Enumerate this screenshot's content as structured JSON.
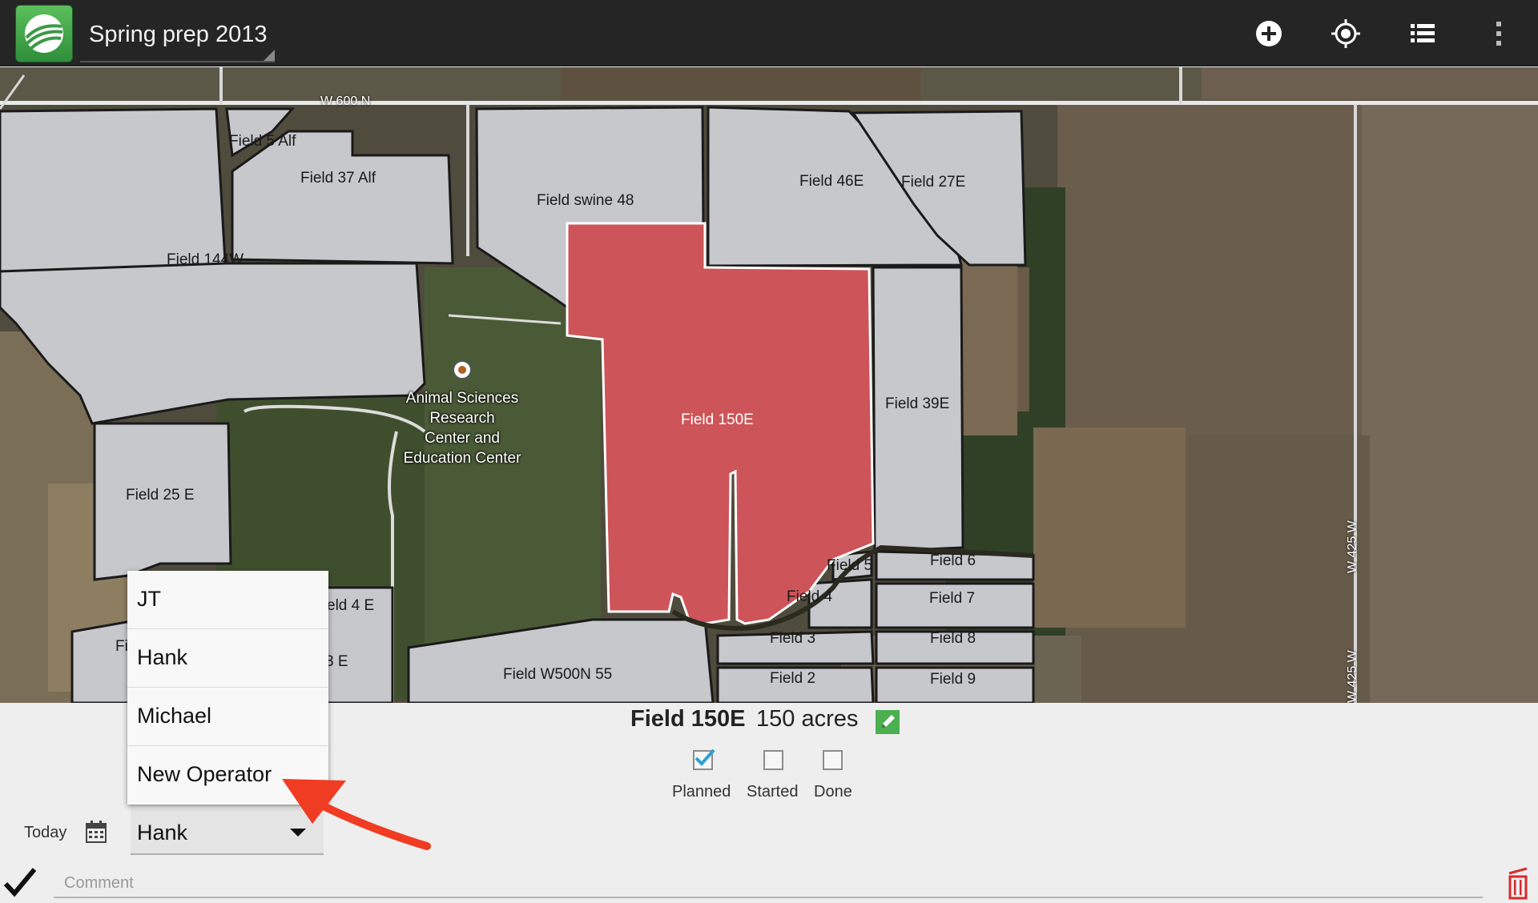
{
  "actionbar": {
    "title": "Spring prep 2013",
    "icons": [
      "app-logo-icon",
      "add-icon",
      "location-target-icon",
      "list-icon",
      "overflow-menu-icon"
    ]
  },
  "map": {
    "roads": {
      "w600n": "W 600 N",
      "w425w_upper": "W 425 W",
      "w425w_lower": "W 425 W"
    },
    "fields": {
      "field_5_alf": "Field 5 Alf",
      "field_37_alf": "Field 37 Alf",
      "field_swine_48": "Field swine 48",
      "field_46e": "Field 46E",
      "field_27e": "Field 27E",
      "field_144w": "Field 144W",
      "field_150e": "Field 150E",
      "field_39e": "Field 39E",
      "field_25e": "Field 25 E",
      "field_4e_partial": "eld 4 E",
      "field_fi_partial": "Fi",
      "field_3e_partial": "3 E",
      "field_5": "Field 5",
      "field_6": "Field 6",
      "field_4": "Field 4",
      "field_7": "Field 7",
      "field_3": "Field 3",
      "field_8": "Field 8",
      "field_2": "Field 2",
      "field_9": "Field 9",
      "field_w500n_55": "Field W500N 55"
    },
    "place_lines": [
      "Animal Sciences",
      "Research",
      "Center and",
      "Education Center"
    ],
    "colors": {
      "field": "#c7c8cc",
      "selected_field": "#cd5458",
      "outline": "#1a1a1a"
    }
  },
  "detail": {
    "field_name": "Field 150E",
    "acres": "150 acres",
    "status": {
      "planned": {
        "label": "Planned",
        "checked": true
      },
      "started": {
        "label": "Started",
        "checked": false
      },
      "done": {
        "label": "Done",
        "checked": false
      }
    },
    "date_label": "Today",
    "operator_value": "Hank",
    "comment_placeholder": "Comment"
  },
  "operator_dropdown": {
    "options": [
      "JT",
      "Hank",
      "Michael",
      "New Operator"
    ]
  },
  "colors": {
    "accent_check": "#2a9fd6",
    "arrow": "#f03c22",
    "trash": "#d62b2b",
    "edit": "#4caf50"
  }
}
